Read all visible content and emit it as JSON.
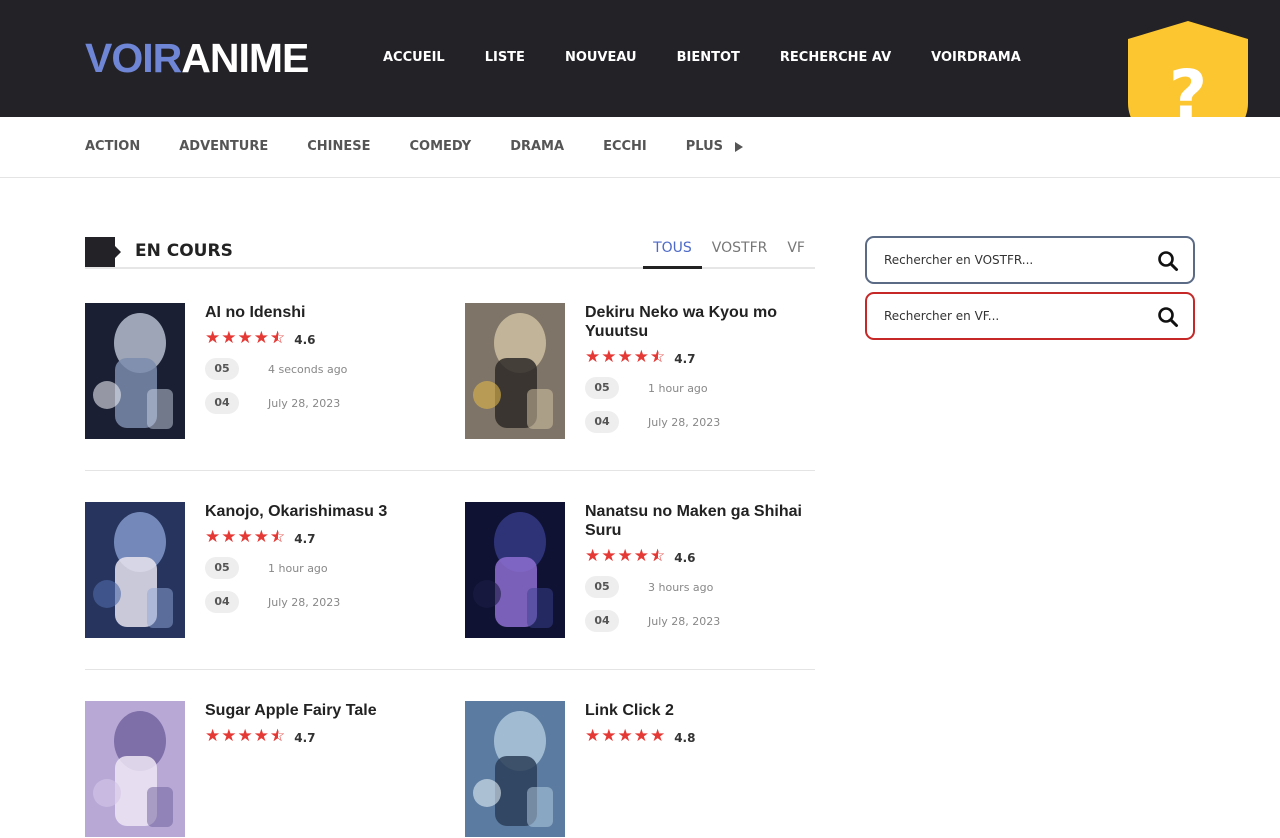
{
  "header": {
    "logo_part1": "VOIR",
    "logo_part2": "ANIME",
    "nav": [
      "ACCUEIL",
      "LISTE",
      "NOUVEAU",
      "BIENTOT",
      "RECHERCHE AV",
      "VOIRDRAMA"
    ],
    "shield_symbol": "?"
  },
  "genres": {
    "items": [
      "ACTION",
      "ADVENTURE",
      "CHINESE",
      "COMEDY",
      "DRAMA",
      "ECCHI"
    ],
    "more_label": "PLUS"
  },
  "section": {
    "title": "EN COURS",
    "tabs": [
      "TOUS",
      "VOSTFR",
      "VF"
    ],
    "active_tab": "TOUS"
  },
  "cards": [
    {
      "title": "AI no Idenshi",
      "rating": "4.6",
      "stars": 4.5,
      "episodes": [
        {
          "num": "05",
          "time": "4 seconds ago"
        },
        {
          "num": "04",
          "time": "July 28, 2023"
        }
      ]
    },
    {
      "title": "Dekiru Neko wa Kyou mo Yuuutsu",
      "rating": "4.7",
      "stars": 4.5,
      "episodes": [
        {
          "num": "05",
          "time": "1 hour ago"
        },
        {
          "num": "04",
          "time": "July 28, 2023"
        }
      ]
    },
    {
      "title": "Kanojo, Okarishimasu 3",
      "rating": "4.7",
      "stars": 4.5,
      "episodes": [
        {
          "num": "05",
          "time": "1 hour ago"
        },
        {
          "num": "04",
          "time": "July 28, 2023"
        }
      ]
    },
    {
      "title": "Nanatsu no Maken ga Shihai Suru",
      "rating": "4.6",
      "stars": 4.5,
      "episodes": [
        {
          "num": "05",
          "time": "3 hours ago"
        },
        {
          "num": "04",
          "time": "July 28, 2023"
        }
      ]
    },
    {
      "title": "Sugar Apple Fairy Tale",
      "rating": "4.7",
      "stars": 4.5,
      "episodes": []
    },
    {
      "title": "Link Click 2",
      "rating": "4.8",
      "stars": 5,
      "episodes": []
    }
  ],
  "sidebar": {
    "search_vostfr_placeholder": "Rechercher en VOSTFR...",
    "search_vf_placeholder": "Rechercher en VF..."
  },
  "colors": {
    "header_bg": "#232227",
    "logo_accent": "#6f86d6",
    "star_red": "#e53935",
    "tab_active": "#4d6ac8",
    "shield_yellow": "#fcc630",
    "vf_border": "#c62828",
    "vostfr_border": "#5b6b86"
  }
}
